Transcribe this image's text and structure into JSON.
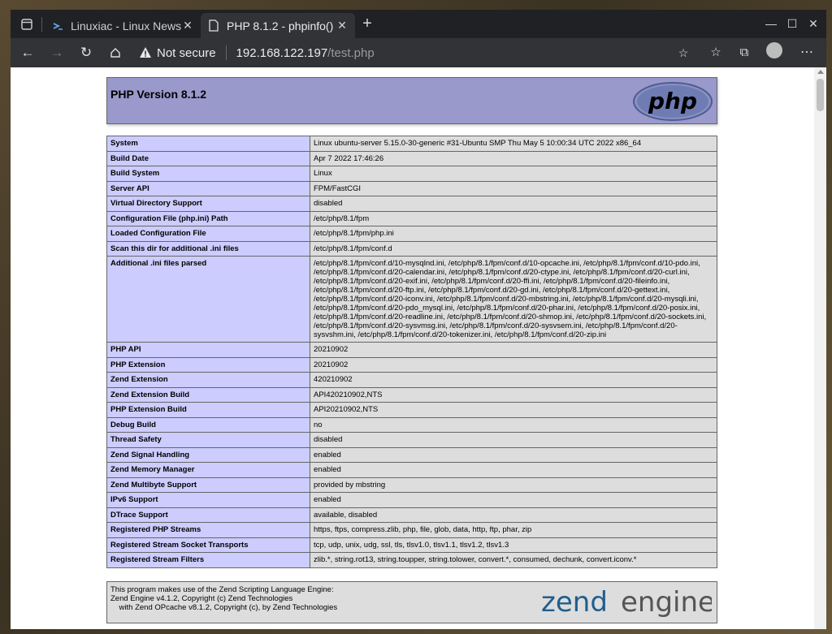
{
  "browser": {
    "tabs": [
      {
        "title": "Linuxiac - Linux News,",
        "favicon": "linuxiac-icon",
        "active": false
      },
      {
        "title": "PHP 8.1.2 - phpinfo()",
        "favicon": "page-icon",
        "active": true
      }
    ],
    "security": "Not secure",
    "url_host": "192.168.122.197",
    "url_path": "/test.php"
  },
  "php": {
    "version_title": "PHP Version 8.1.2",
    "logo_text": "php",
    "rows": [
      {
        "k": "System",
        "v": "Linux ubuntu-server 5.15.0-30-generic #31-Ubuntu SMP Thu May 5 10:00:34 UTC 2022 x86_64"
      },
      {
        "k": "Build Date",
        "v": "Apr 7 2022 17:46:26"
      },
      {
        "k": "Build System",
        "v": "Linux"
      },
      {
        "k": "Server API",
        "v": "FPM/FastCGI"
      },
      {
        "k": "Virtual Directory Support",
        "v": "disabled"
      },
      {
        "k": "Configuration File (php.ini) Path",
        "v": "/etc/php/8.1/fpm"
      },
      {
        "k": "Loaded Configuration File",
        "v": "/etc/php/8.1/fpm/php.ini"
      },
      {
        "k": "Scan this dir for additional .ini files",
        "v": "/etc/php/8.1/fpm/conf.d"
      },
      {
        "k": "Additional .ini files parsed",
        "v": "/etc/php/8.1/fpm/conf.d/10-mysqlnd.ini, /etc/php/8.1/fpm/conf.d/10-opcache.ini, /etc/php/8.1/fpm/conf.d/10-pdo.ini, /etc/php/8.1/fpm/conf.d/20-calendar.ini, /etc/php/8.1/fpm/conf.d/20-ctype.ini, /etc/php/8.1/fpm/conf.d/20-curl.ini, /etc/php/8.1/fpm/conf.d/20-exif.ini, /etc/php/8.1/fpm/conf.d/20-ffi.ini, /etc/php/8.1/fpm/conf.d/20-fileinfo.ini, /etc/php/8.1/fpm/conf.d/20-ftp.ini, /etc/php/8.1/fpm/conf.d/20-gd.ini, /etc/php/8.1/fpm/conf.d/20-gettext.ini, /etc/php/8.1/fpm/conf.d/20-iconv.ini, /etc/php/8.1/fpm/conf.d/20-mbstring.ini, /etc/php/8.1/fpm/conf.d/20-mysqli.ini, /etc/php/8.1/fpm/conf.d/20-pdo_mysql.ini, /etc/php/8.1/fpm/conf.d/20-phar.ini, /etc/php/8.1/fpm/conf.d/20-posix.ini, /etc/php/8.1/fpm/conf.d/20-readline.ini, /etc/php/8.1/fpm/conf.d/20-shmop.ini, /etc/php/8.1/fpm/conf.d/20-sockets.ini, /etc/php/8.1/fpm/conf.d/20-sysvmsg.ini, /etc/php/8.1/fpm/conf.d/20-sysvsem.ini, /etc/php/8.1/fpm/conf.d/20-sysvshm.ini, /etc/php/8.1/fpm/conf.d/20-tokenizer.ini, /etc/php/8.1/fpm/conf.d/20-zip.ini"
      },
      {
        "k": "PHP API",
        "v": "20210902"
      },
      {
        "k": "PHP Extension",
        "v": "20210902"
      },
      {
        "k": "Zend Extension",
        "v": "420210902"
      },
      {
        "k": "Zend Extension Build",
        "v": "API420210902,NTS"
      },
      {
        "k": "PHP Extension Build",
        "v": "API20210902,NTS"
      },
      {
        "k": "Debug Build",
        "v": "no"
      },
      {
        "k": "Thread Safety",
        "v": "disabled"
      },
      {
        "k": "Zend Signal Handling",
        "v": "enabled"
      },
      {
        "k": "Zend Memory Manager",
        "v": "enabled"
      },
      {
        "k": "Zend Multibyte Support",
        "v": "provided by mbstring"
      },
      {
        "k": "IPv6 Support",
        "v": "enabled"
      },
      {
        "k": "DTrace Support",
        "v": "available, disabled"
      },
      {
        "k": "Registered PHP Streams",
        "v": "https, ftps, compress.zlib, php, file, glob, data, http, ftp, phar, zip"
      },
      {
        "k": "Registered Stream Socket Transports",
        "v": "tcp, udp, unix, udg, ssl, tls, tlsv1.0, tlsv1.1, tlsv1.2, tlsv1.3"
      },
      {
        "k": "Registered Stream Filters",
        "v": "zlib.*, string.rot13, string.toupper, string.tolower, convert.*, consumed, dechunk, convert.iconv.*"
      }
    ],
    "footer_lines": [
      "This program makes use of the Zend Scripting Language Engine:",
      "Zend Engine v4.1.2, Copyright (c) Zend Technologies",
      "    with Zend OPcache v8.1.2, Copyright (c), by Zend Technologies"
    ],
    "zend_logo": {
      "left": "zend",
      "right": "engine"
    }
  },
  "colors": {
    "header_bg": "#9999cc",
    "key_bg": "#ccccff",
    "value_bg": "#dddddd"
  }
}
